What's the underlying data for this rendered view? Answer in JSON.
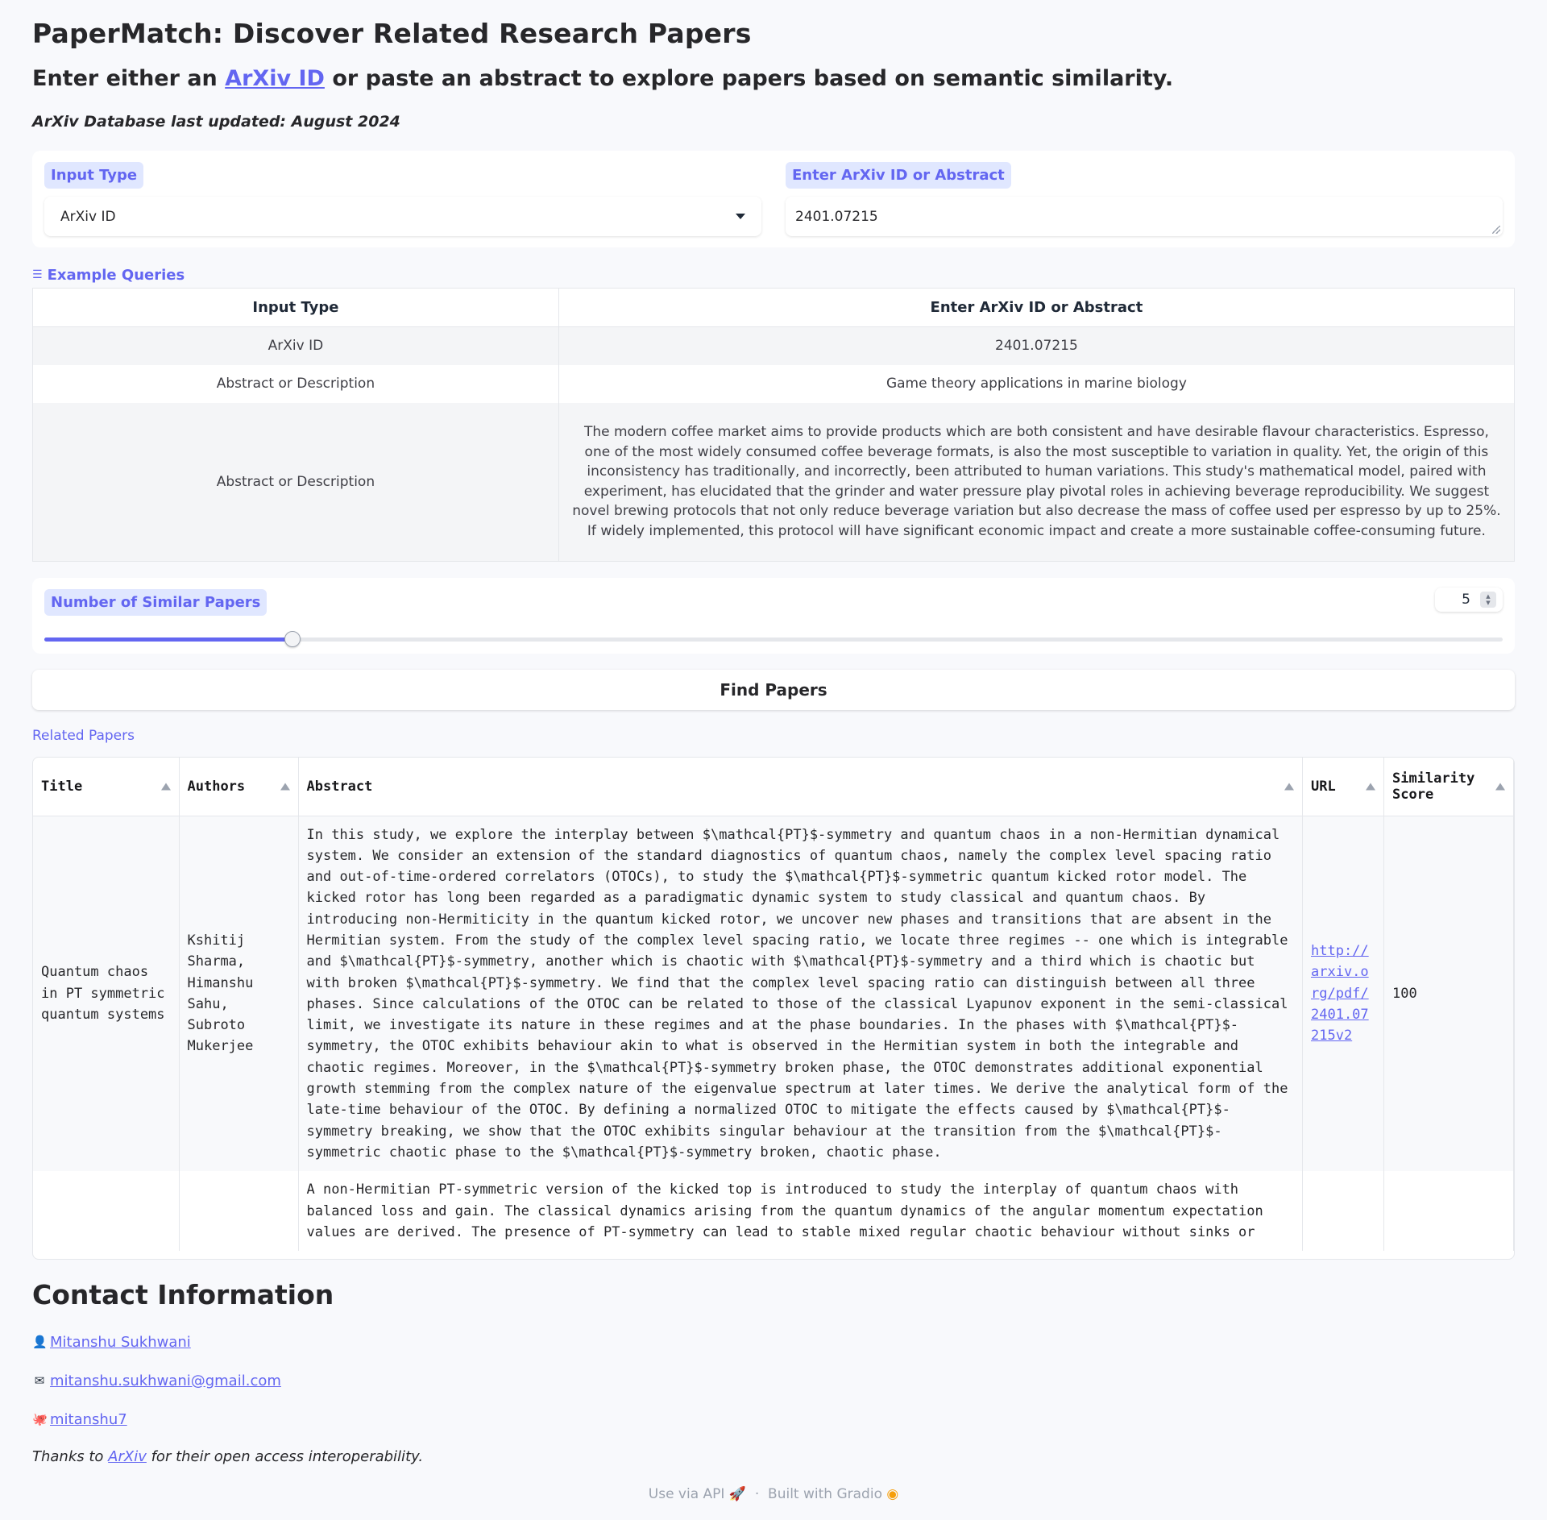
{
  "header": {
    "title": "PaperMatch: Discover Related Research Papers",
    "subtitle_before": "Enter either an ",
    "subtitle_link": "ArXiv ID",
    "subtitle_after": " or paste an abstract to explore papers based on semantic similarity.",
    "updated": "ArXiv Database last updated: August 2024"
  },
  "inputs": {
    "input_type_label": "Input Type",
    "input_type_value": "ArXiv ID",
    "query_label": "Enter ArXiv ID or Abstract",
    "query_value": "2401.07215"
  },
  "examples": {
    "label": "Example Queries",
    "headers": [
      "Input Type",
      "Enter ArXiv ID or Abstract"
    ],
    "rows": [
      [
        "ArXiv ID",
        "2401.07215"
      ],
      [
        "Abstract or Description",
        "Game theory applications in marine biology"
      ],
      [
        "Abstract or Description",
        "The modern coffee market aims to provide products which are both consistent and have desirable flavour characteristics. Espresso, one of the most widely consumed coffee beverage formats, is also the most susceptible to variation in quality. Yet, the origin of this inconsistency has traditionally, and incorrectly, been attributed to human variations. This study's mathematical model, paired with experiment, has elucidated that the grinder and water pressure play pivotal roles in achieving beverage reproducibility. We suggest novel brewing protocols that not only reduce beverage variation but also decrease the mass of coffee used per espresso by up to 25%. If widely implemented, this protocol will have significant economic impact and create a more sustainable coffee-consuming future."
      ]
    ]
  },
  "slider": {
    "label": "Number of Similar Papers",
    "value": "5",
    "fraction": 0.17
  },
  "find_button": "Find Papers",
  "results": {
    "label": "Related Papers",
    "headers": [
      "Title",
      "Authors",
      "Abstract",
      "URL",
      "Similarity Score"
    ],
    "rows": [
      {
        "title": "Quantum chaos in PT symmetric quantum systems",
        "authors": "Kshitij Sharma, Himanshu Sahu, Subroto Mukerjee",
        "abstract": "In this study, we explore the interplay between $\\mathcal{PT}$-symmetry and quantum chaos in a non-Hermitian dynamical system. We consider an extension of the standard diagnostics of quantum chaos, namely the complex level spacing ratio and out-of-time-ordered correlators (OTOCs), to study the $\\mathcal{PT}$-symmetric quantum kicked rotor model. The kicked rotor has long been regarded as a paradigmatic dynamic system to study classical and quantum chaos. By introducing non-Hermiticity in the quantum kicked rotor, we uncover new phases and transitions that are absent in the Hermitian system. From the study of the complex level spacing ratio, we locate three regimes -- one which is integrable and $\\mathcal{PT}$-symmetry, another which is chaotic with $\\mathcal{PT}$-symmetry and a third which is chaotic but with broken $\\mathcal{PT}$-symmetry. We find that the complex level spacing ratio can distinguish between all three phases. Since calculations of the OTOC can be related to those of the classical Lyapunov exponent in the semi-classical limit, we investigate its nature in these regimes and at the phase boundaries. In the phases with $\\mathcal{PT}$-symmetry, the OTOC exhibits behaviour akin to what is observed in the Hermitian system in both the integrable and chaotic regimes. Moreover, in the $\\mathcal{PT}$-symmetry broken phase, the OTOC demonstrates additional exponential growth stemming from the complex nature of the eigenvalue spectrum at later times. We derive the analytical form of the late-time behaviour of the OTOC. By defining a normalized OTOC to mitigate the effects caused by $\\mathcal{PT}$-symmetry breaking, we show that the OTOC exhibits singular behaviour at the transition from the $\\mathcal{PT}$-symmetric chaotic phase to the $\\mathcal{PT}$-symmetry broken, chaotic phase.",
        "url": "http://arxiv.org/pdf/2401.07215v2",
        "score": "100"
      },
      {
        "title": "",
        "authors": "",
        "abstract": "A non-Hermitian PT-symmetric version of the kicked top is introduced to study the interplay of quantum chaos with balanced loss and gain. The classical dynamics arising from the quantum dynamics of the angular momentum expectation values are derived. The presence of PT-symmetry can lead to stable mixed regular chaotic behaviour without sinks or",
        "url": "",
        "score": ""
      }
    ]
  },
  "contact": {
    "heading": "Contact Information",
    "name_icon": "person-icon",
    "name": "Mitanshu Sukhwani",
    "email_icon": "envelope-icon",
    "email": "mitanshu.sukhwani@gmail.com",
    "github_icon": "octopus-icon",
    "github": "mitanshu7",
    "thanks_before": "Thanks to ",
    "thanks_link": "ArXiv",
    "thanks_after": " for their open access interoperability."
  },
  "footer": {
    "api": "Use via API",
    "sep": "·",
    "built": "Built with Gradio"
  },
  "colors": {
    "accent": "#6366f1",
    "accent_bg": "#e0e7ff",
    "page_bg": "#f8f9fc"
  }
}
